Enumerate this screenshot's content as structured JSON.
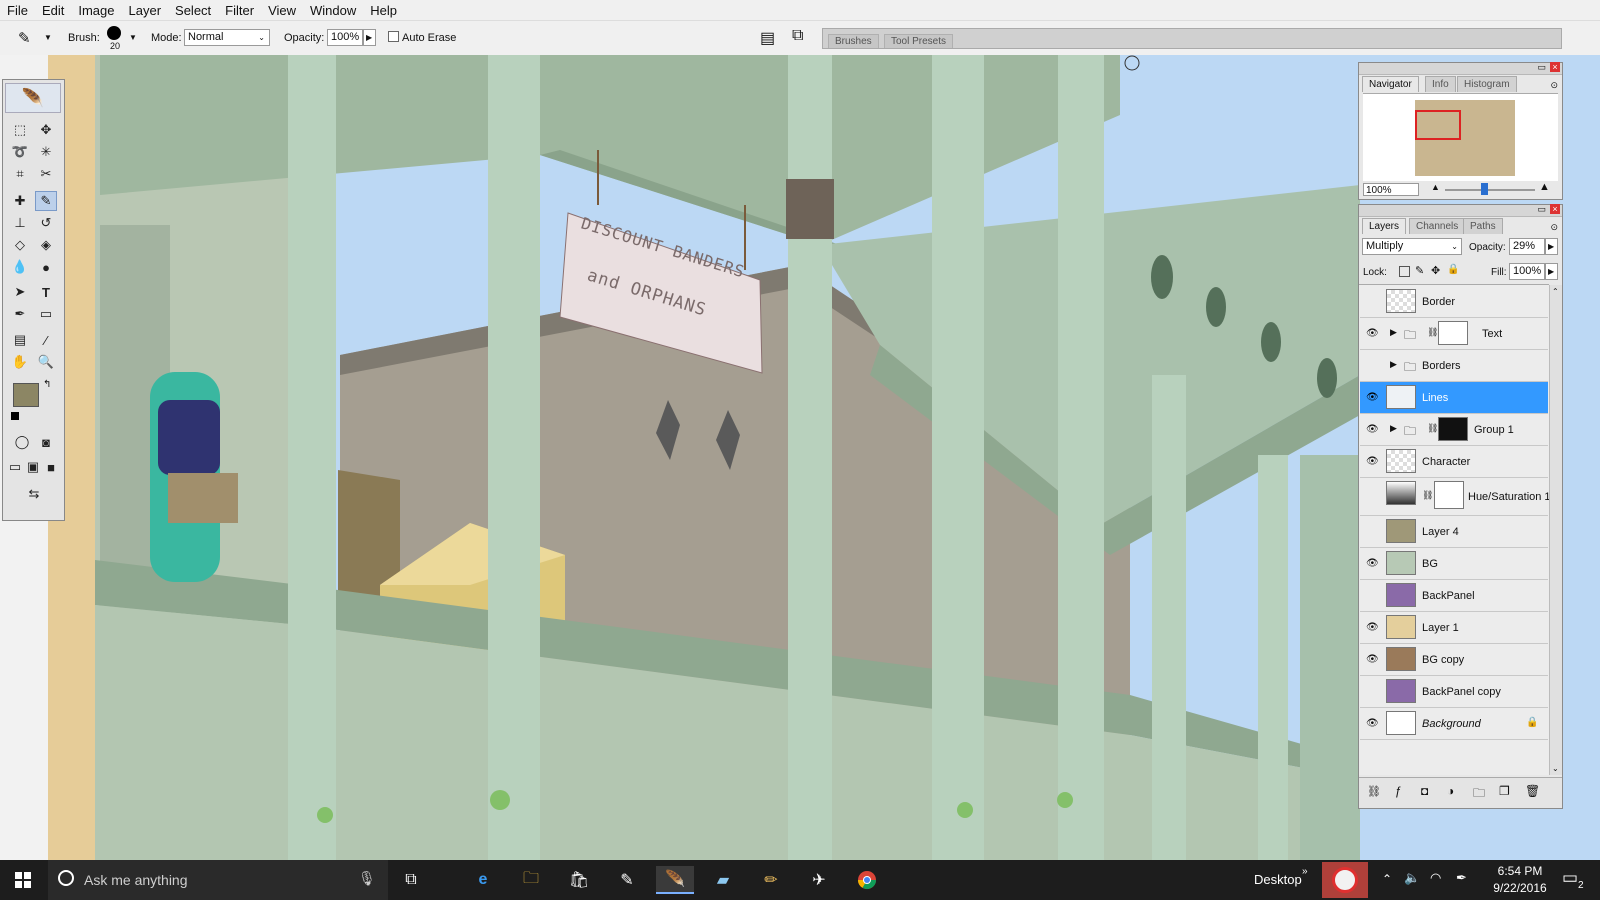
{
  "menubar": {
    "items": [
      "File",
      "Edit",
      "Image",
      "Layer",
      "Select",
      "Filter",
      "View",
      "Window",
      "Help"
    ]
  },
  "options": {
    "brush_label": "Brush:",
    "brush_size": "20",
    "mode_label": "Mode:",
    "mode_value": "Normal",
    "opacity_label": "Opacity:",
    "opacity_value": "100%",
    "auto_erase_label": "Auto Erase",
    "well_tabs": [
      "Brushes",
      "Tool Presets"
    ]
  },
  "artwork": {
    "sign_line1": "DISCOUNT BANDERS",
    "sign_line2": "and ORPHANS"
  },
  "navigator": {
    "tabs": [
      "Navigator",
      "Info",
      "Histogram"
    ],
    "zoom": "100%"
  },
  "layers_panel": {
    "tabs": [
      "Layers",
      "Channels",
      "Paths"
    ],
    "blend_mode": "Multiply",
    "opacity_label": "Opacity:",
    "opacity_value": "29%",
    "lock_label": "Lock:",
    "fill_label": "Fill:",
    "fill_value": "100%",
    "layers": [
      {
        "name": "Border",
        "visible": false,
        "type": "layer"
      },
      {
        "name": "Text",
        "visible": true,
        "type": "group-mask"
      },
      {
        "name": "Borders",
        "visible": false,
        "type": "group"
      },
      {
        "name": "Lines",
        "visible": true,
        "type": "layer",
        "selected": true
      },
      {
        "name": "Group 1",
        "visible": true,
        "type": "group-mask"
      },
      {
        "name": "Character",
        "visible": true,
        "type": "layer"
      },
      {
        "name": "Hue/Saturation 1",
        "visible": false,
        "type": "adjustment"
      },
      {
        "name": "Layer 4",
        "visible": false,
        "type": "layer"
      },
      {
        "name": "BG",
        "visible": true,
        "type": "layer"
      },
      {
        "name": "BackPanel",
        "visible": false,
        "type": "layer"
      },
      {
        "name": "Layer 1",
        "visible": true,
        "type": "layer"
      },
      {
        "name": "BG copy",
        "visible": true,
        "type": "layer"
      },
      {
        "name": "BackPanel copy",
        "visible": false,
        "type": "layer"
      },
      {
        "name": "Background",
        "visible": true,
        "type": "background"
      }
    ]
  },
  "taskbar": {
    "search_placeholder": "Ask me anything",
    "desktop_label": "Desktop",
    "time": "6:54 PM",
    "date": "9/22/2016",
    "notification_count": "2"
  },
  "colors": {
    "selection": "#3399ff",
    "foreground_swatch": "#8c8664",
    "background_swatch": "#c8c29a"
  }
}
